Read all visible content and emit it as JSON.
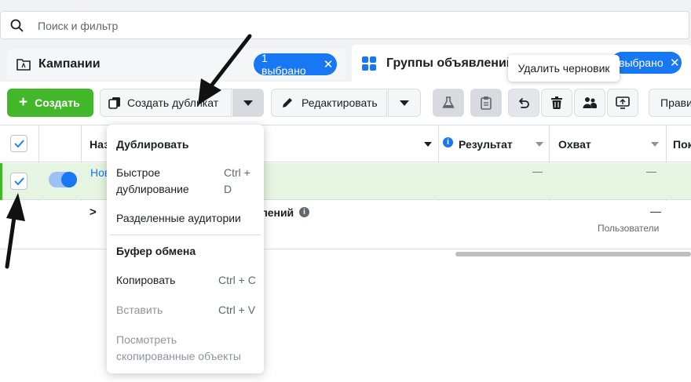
{
  "search": {
    "placeholder": "Поиск и фильтр"
  },
  "tabs": {
    "campaigns": {
      "label": "Кампании",
      "selected": "1 выбрано",
      "close": "✕"
    },
    "adsets": {
      "label": "Группы объявлений",
      "selected": "выбрано",
      "close": "✕"
    }
  },
  "tooltip": {
    "text": "Удалить черновик"
  },
  "toolbar": {
    "create_label": "Создать",
    "create_plus": "+",
    "duplicate_label": "Создать дубликат",
    "edit_label": "Редактировать",
    "rules_label": "Прави"
  },
  "table": {
    "headers": {
      "name": "Наз",
      "result": "Результат",
      "reach": "Охват",
      "next": "Пок"
    },
    "row1": {
      "name": "Нов",
      "result": "—",
      "reach": "—"
    },
    "row2": {
      "chevron": ">",
      "label": "лений",
      "reach": "—",
      "reach_sub": "Пользователи"
    }
  },
  "menu": {
    "duplicate_heading": "Дублировать",
    "quick_dup_line1": "Быстрое",
    "quick_dup_line2": "дублирование",
    "quick_dup_shortcut_line1": "Ctrl +",
    "quick_dup_shortcut_line2": "D",
    "split_audiences": "Разделенные аудитории",
    "clipboard_heading": "Буфер обмена",
    "copy": "Копировать",
    "copy_shortcut": "Ctrl + C",
    "paste": "Вставить",
    "paste_shortcut": "Ctrl + V",
    "view_copied_line1": "Посмотреть",
    "view_copied_line2": "скопированные объекты"
  },
  "colors": {
    "accent": "#1877f2",
    "create_green": "#42b72a",
    "row_highlight": "#e6f5e1"
  }
}
